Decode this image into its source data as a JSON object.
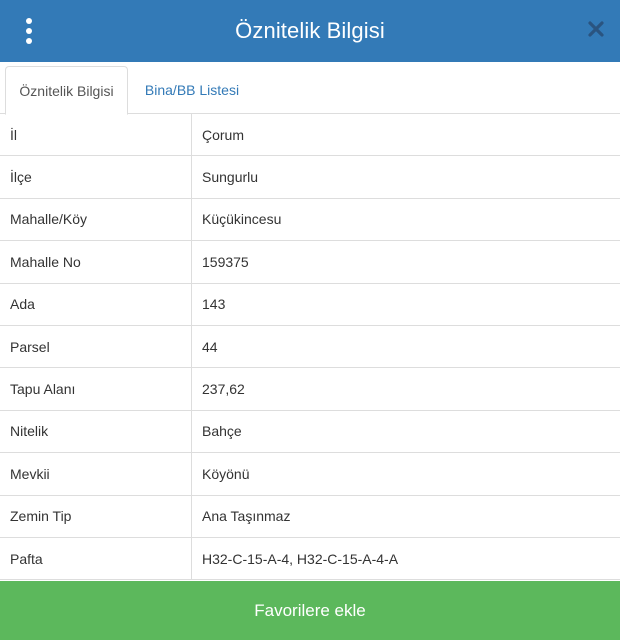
{
  "header": {
    "title": "Öznitelik Bilgisi",
    "menu_icon": "vertical-dots-icon",
    "close_icon": "close-icon"
  },
  "tabs": [
    {
      "label": "Öznitelik Bilgisi",
      "active": true
    },
    {
      "label": "Bina/BB Listesi",
      "active": false
    }
  ],
  "attributes": [
    {
      "label": "İl",
      "value": "Çorum"
    },
    {
      "label": "İlçe",
      "value": "Sungurlu"
    },
    {
      "label": "Mahalle/Köy",
      "value": "Küçükincesu"
    },
    {
      "label": "Mahalle No",
      "value": "159375"
    },
    {
      "label": "Ada",
      "value": "143"
    },
    {
      "label": "Parsel",
      "value": "44"
    },
    {
      "label": "Tapu Alanı",
      "value": "237,62"
    },
    {
      "label": "Nitelik",
      "value": "Bahçe"
    },
    {
      "label": "Mevkii",
      "value": "Köyönü"
    },
    {
      "label": "Zemin Tip",
      "value": "Ana Taşınmaz"
    },
    {
      "label": "Pafta",
      "value": "H32-C-15-A-4, H32-C-15-A-4-A"
    }
  ],
  "footer": {
    "favorite_label": "Favorilere ekle"
  },
  "colors": {
    "header_bg": "#337ab7",
    "button_bg": "#5cb85c",
    "link": "#337ab7",
    "border": "#dddddd"
  }
}
